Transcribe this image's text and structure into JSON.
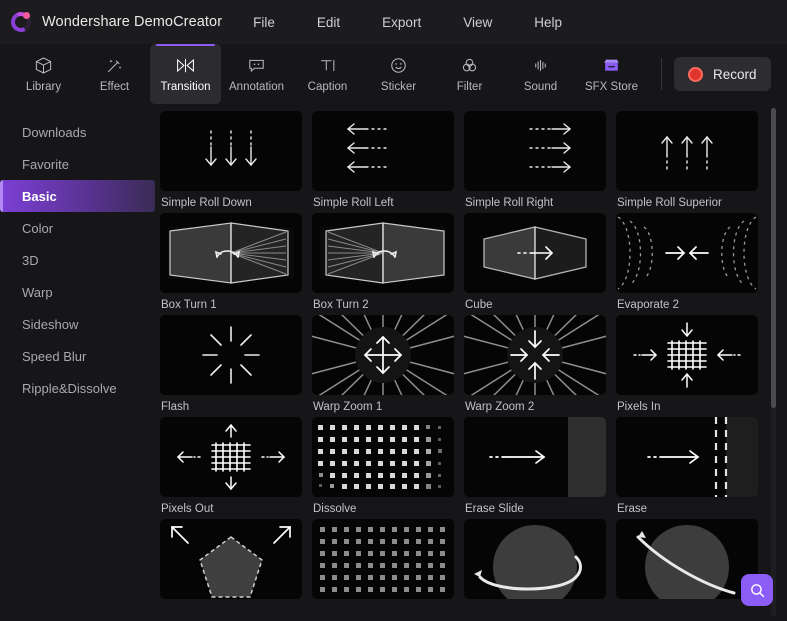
{
  "app": {
    "title": "Wondershare DemoCreator",
    "logo_icon": "democreator-logo-icon"
  },
  "menubar": {
    "items": [
      {
        "label": "File"
      },
      {
        "label": "Edit"
      },
      {
        "label": "Export"
      },
      {
        "label": "View"
      },
      {
        "label": "Help"
      }
    ]
  },
  "toolbar": {
    "tabs": [
      {
        "label": "Library",
        "icon": "cube-icon",
        "active": false
      },
      {
        "label": "Effect",
        "icon": "magic-wand-icon",
        "active": false
      },
      {
        "label": "Transition",
        "icon": "transition-icon",
        "active": true
      },
      {
        "label": "Annotation",
        "icon": "callout-icon",
        "active": false
      },
      {
        "label": "Caption",
        "icon": "text-icon",
        "active": false
      },
      {
        "label": "Sticker",
        "icon": "smiley-icon",
        "active": false
      },
      {
        "label": "Filter",
        "icon": "circles-icon",
        "active": false
      },
      {
        "label": "Sound",
        "icon": "waveform-icon",
        "active": false
      },
      {
        "label": "SFX Store",
        "icon": "store-icon",
        "active": false
      }
    ],
    "record": {
      "label": "Record",
      "icon": "record-dot-icon"
    }
  },
  "sidebar": {
    "items": [
      {
        "label": "Downloads",
        "active": false
      },
      {
        "label": "Favorite",
        "active": false
      },
      {
        "label": "Basic",
        "active": true
      },
      {
        "label": "Color",
        "active": false
      },
      {
        "label": "3D",
        "active": false
      },
      {
        "label": "Warp",
        "active": false
      },
      {
        "label": "Sideshow",
        "active": false
      },
      {
        "label": "Speed Blur",
        "active": false
      },
      {
        "label": "Ripple&Dissolve",
        "active": false
      }
    ]
  },
  "transitions": {
    "items": [
      {
        "label": "Simple Roll Down",
        "thumb": "roll-down"
      },
      {
        "label": "Simple Roll Left",
        "thumb": "roll-left"
      },
      {
        "label": "Simple Roll Right",
        "thumb": "roll-right"
      },
      {
        "label": "Simple Roll Superior",
        "thumb": "roll-up"
      },
      {
        "label": "Box Turn 1",
        "thumb": "box-turn-1"
      },
      {
        "label": "Box Turn 2",
        "thumb": "box-turn-2"
      },
      {
        "label": "Cube",
        "thumb": "cube"
      },
      {
        "label": "Evaporate 2",
        "thumb": "evaporate-2"
      },
      {
        "label": "Flash",
        "thumb": "flash"
      },
      {
        "label": "Warp Zoom 1",
        "thumb": "warp-zoom-1"
      },
      {
        "label": "Warp Zoom 2",
        "thumb": "warp-zoom-2"
      },
      {
        "label": "Pixels In",
        "thumb": "pixels-in"
      },
      {
        "label": "Pixels Out",
        "thumb": "pixels-out"
      },
      {
        "label": "Dissolve",
        "thumb": "dissolve"
      },
      {
        "label": "Erase Slide",
        "thumb": "erase-slide"
      },
      {
        "label": "Erase",
        "thumb": "erase"
      },
      {
        "label": "",
        "thumb": "shape-zoom"
      },
      {
        "label": "",
        "thumb": "dots-grid"
      },
      {
        "label": "",
        "thumb": "sphere-spin-1"
      },
      {
        "label": "",
        "thumb": "sphere-spin-2"
      }
    ]
  },
  "search": {
    "icon": "search-icon",
    "label": "Search"
  },
  "colors": {
    "accent": "#8b5cf6",
    "active_sidebar": "#7b3fd4",
    "record": "#e0352b",
    "panel_bg": "#161618",
    "titlebar_bg": "#1c1c1e"
  }
}
